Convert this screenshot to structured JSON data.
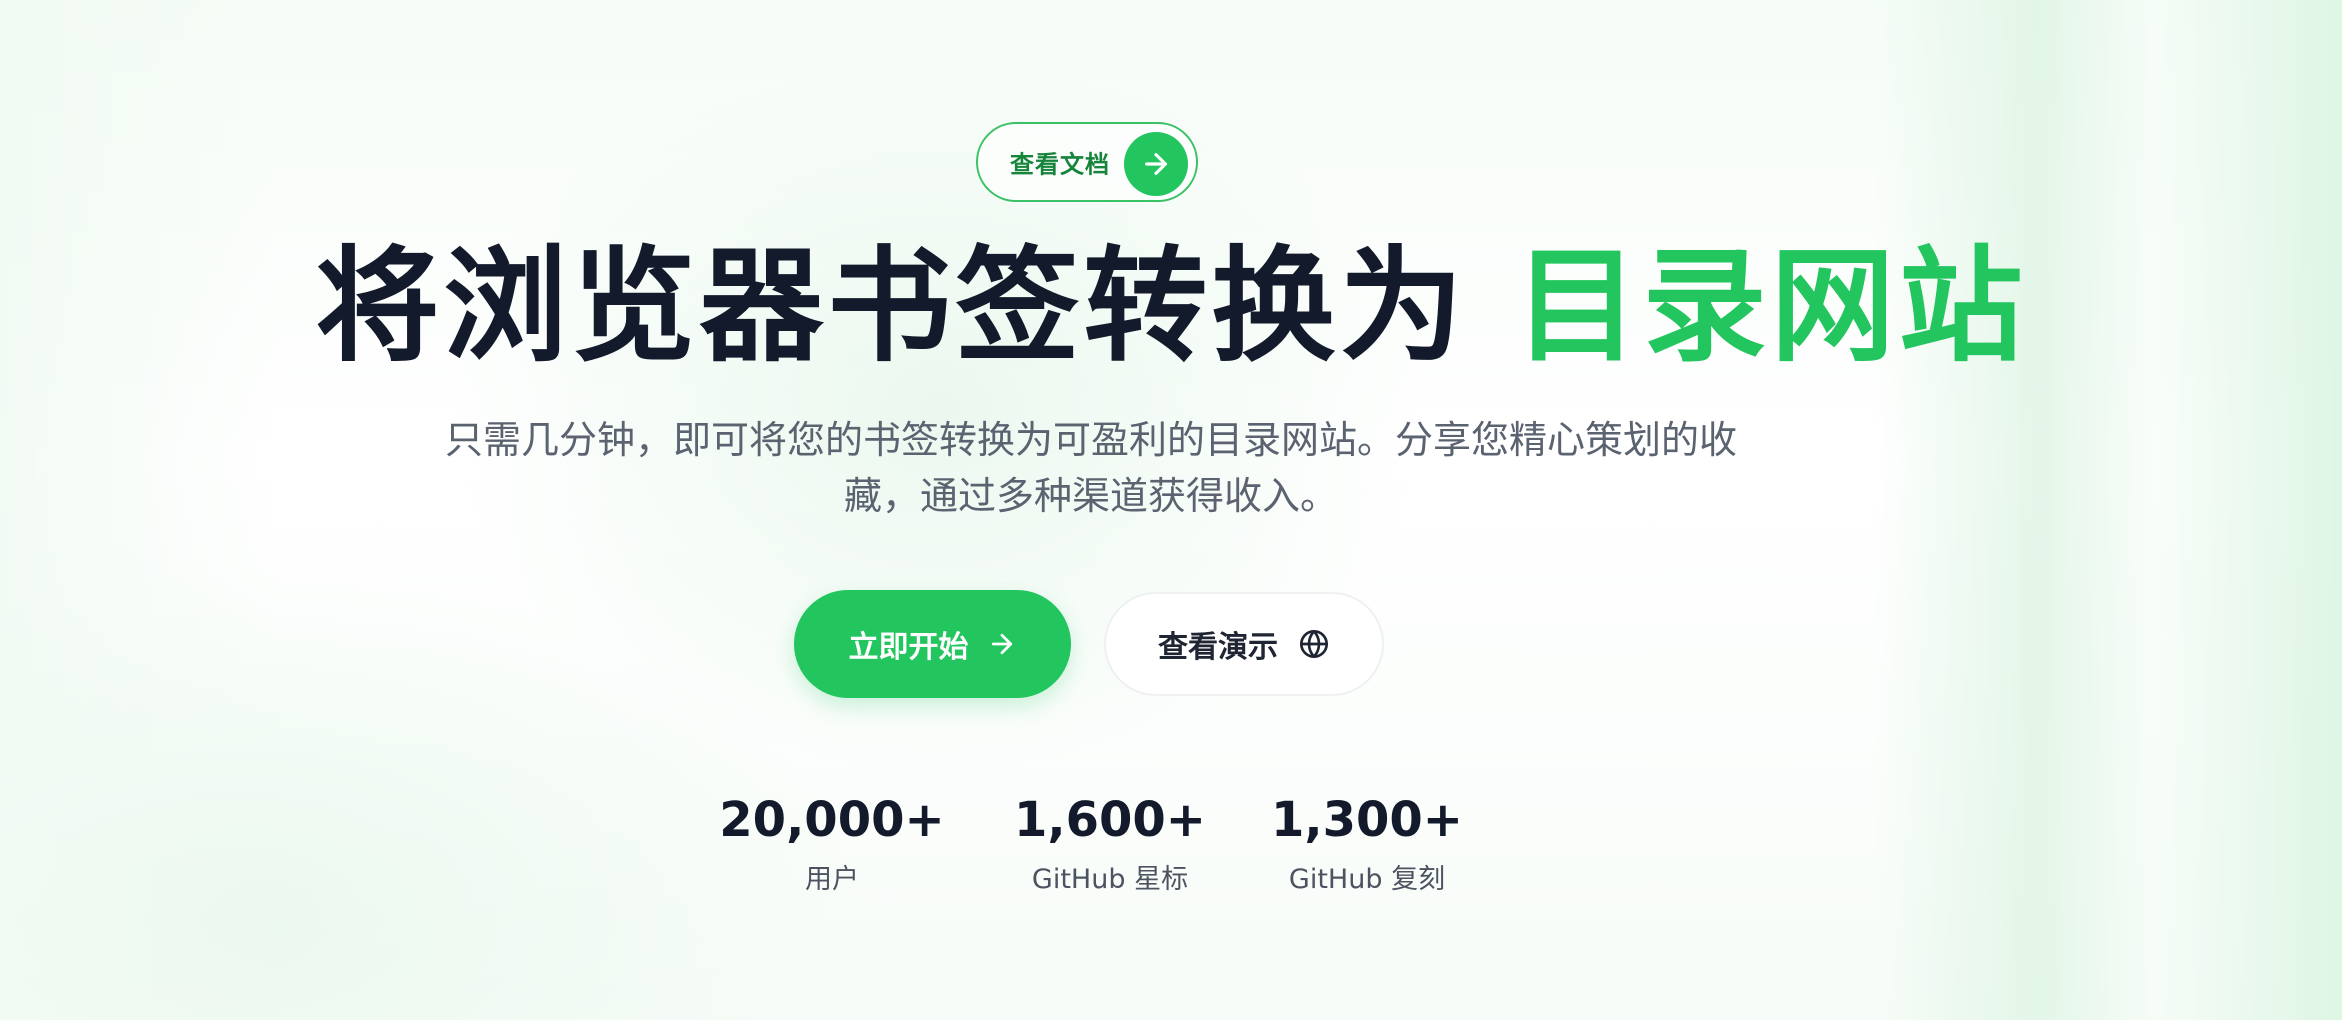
{
  "docs_pill": {
    "label": "查看文档"
  },
  "hero": {
    "title_main": "将浏览器书签转换为",
    "title_accent": "目录网站",
    "subtitle": "只需几分钟，即可将您的书签转换为可盈利的目录网站。分享您精心策划的收藏，通过多种渠道获得收入。"
  },
  "actions": {
    "primary_label": "立即开始",
    "secondary_label": "查看演示"
  },
  "stats": [
    {
      "value": "20,000+",
      "caption": "用户"
    },
    {
      "value": "1,600+",
      "caption": "GitHub 星标"
    },
    {
      "value": "1,300+",
      "caption": "GitHub 复刻"
    }
  ],
  "colors": {
    "accent": "#22c55e",
    "heading": "#131a2b",
    "body": "#5b6270"
  },
  "icons": {
    "docs_arrow": "arrow-right-icon",
    "primary_arrow": "arrow-right-icon",
    "secondary_globe": "globe-icon"
  }
}
